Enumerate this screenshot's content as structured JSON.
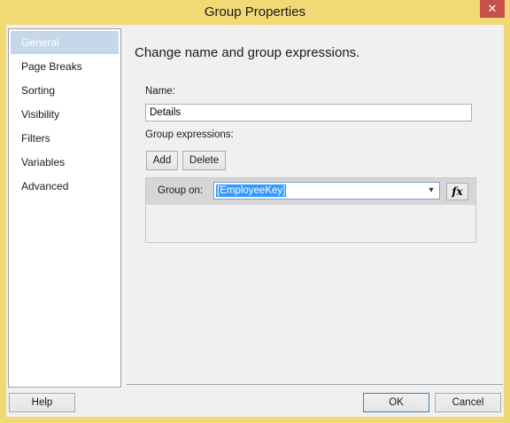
{
  "window": {
    "title": "Group Properties",
    "close_glyph": "✕"
  },
  "sidebar": {
    "items": [
      {
        "label": "General",
        "selected": true
      },
      {
        "label": "Page Breaks"
      },
      {
        "label": "Sorting"
      },
      {
        "label": "Visibility"
      },
      {
        "label": "Filters"
      },
      {
        "label": "Variables"
      },
      {
        "label": "Advanced"
      }
    ]
  },
  "main": {
    "heading": "Change name and group expressions.",
    "name_label": "Name:",
    "name_value": "Details",
    "group_expressions_label": "Group expressions:",
    "add_label": "Add",
    "delete_label": "Delete",
    "group_on_label": "Group on:",
    "group_on_value": "[EmployeeKey]",
    "fx_label": "fx",
    "dropdown_glyph": "▾"
  },
  "footer": {
    "help_label": "Help",
    "ok_label": "OK",
    "cancel_label": "Cancel"
  },
  "colors": {
    "title_bar": "#f3d976",
    "selected_nav": "#c6d7ea",
    "close_button": "#c7504b",
    "selection_highlight": "#3399ff"
  }
}
